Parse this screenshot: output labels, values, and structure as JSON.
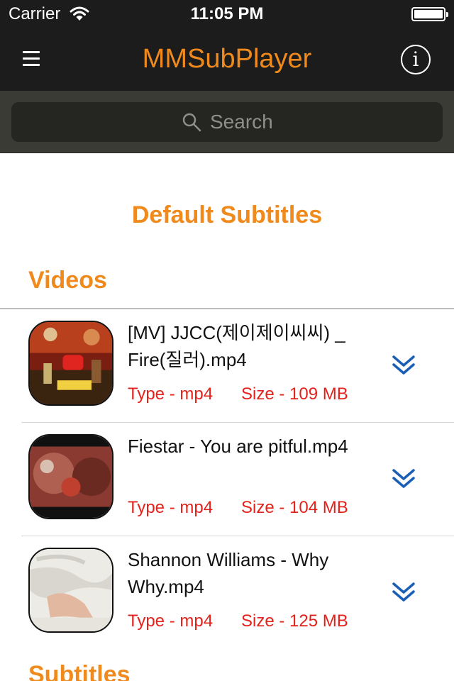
{
  "status_bar": {
    "carrier": "Carrier",
    "time": "11:05 PM"
  },
  "nav": {
    "title": "MMSubPlayer",
    "menu_icon": "hamburger-menu-icon",
    "info_icon": "info-icon",
    "info_glyph": "i"
  },
  "search": {
    "placeholder": "Search",
    "icon": "search-icon"
  },
  "header": {
    "title": "Default Subtitles"
  },
  "sections": {
    "videos": "Videos",
    "subtitles": "Subtitles"
  },
  "videos": [
    {
      "name": "[MV] JJCC(제이제이씨씨) _ Fire(질러).mp4",
      "type": "Type - mp4",
      "size": "Size - 109 MB"
    },
    {
      "name": "Fiestar - You are pitful.mp4",
      "type": "Type - mp4",
      "size": "Size - 104 MB"
    },
    {
      "name": "Shannon Williams - Why Why.mp4",
      "type": "Type - mp4",
      "size": "Size - 125 MB"
    }
  ],
  "colors": {
    "accent": "#f08a1c",
    "meta_text": "#e3221c",
    "expand_icon": "#1a5fb4",
    "bar_background": "#1c1c1c"
  }
}
